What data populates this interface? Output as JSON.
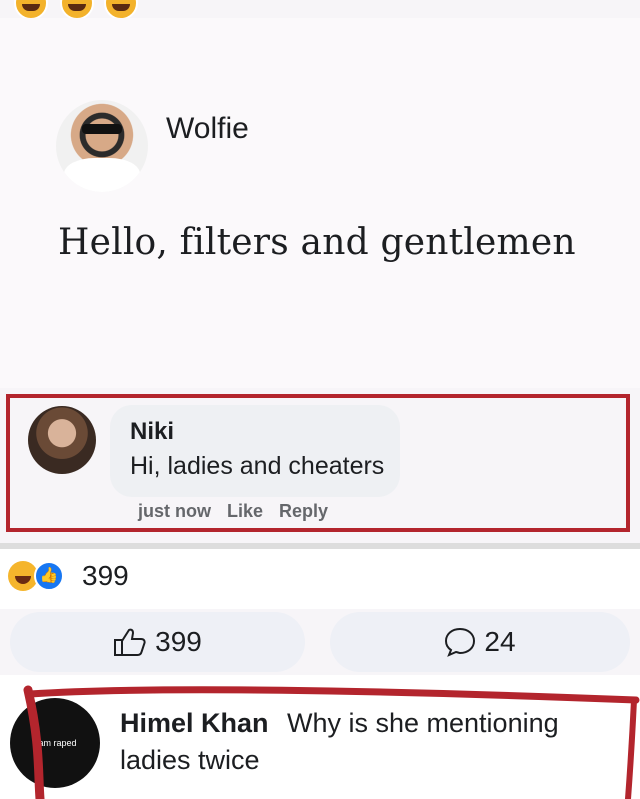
{
  "post": {
    "author": "Wolfie",
    "text": "Hello, filters and gentlemen"
  },
  "comment": {
    "author": "Niki",
    "text": "Hi, ladies and cheaters",
    "time": "just now",
    "like_label": "Like",
    "reply_label": "Reply"
  },
  "reactions": {
    "count": "399",
    "icons": [
      "haha-icon",
      "like-icon"
    ]
  },
  "actions": {
    "like_count": "399",
    "comment_count": "24"
  },
  "reply": {
    "author": "Himel Khan",
    "text_line1": "Why is she mentioning",
    "text_line2": "ladies twice",
    "avatar_text": "I am raped"
  },
  "colors": {
    "highlight": "#b3252d",
    "like_blue": "#1877f2"
  }
}
